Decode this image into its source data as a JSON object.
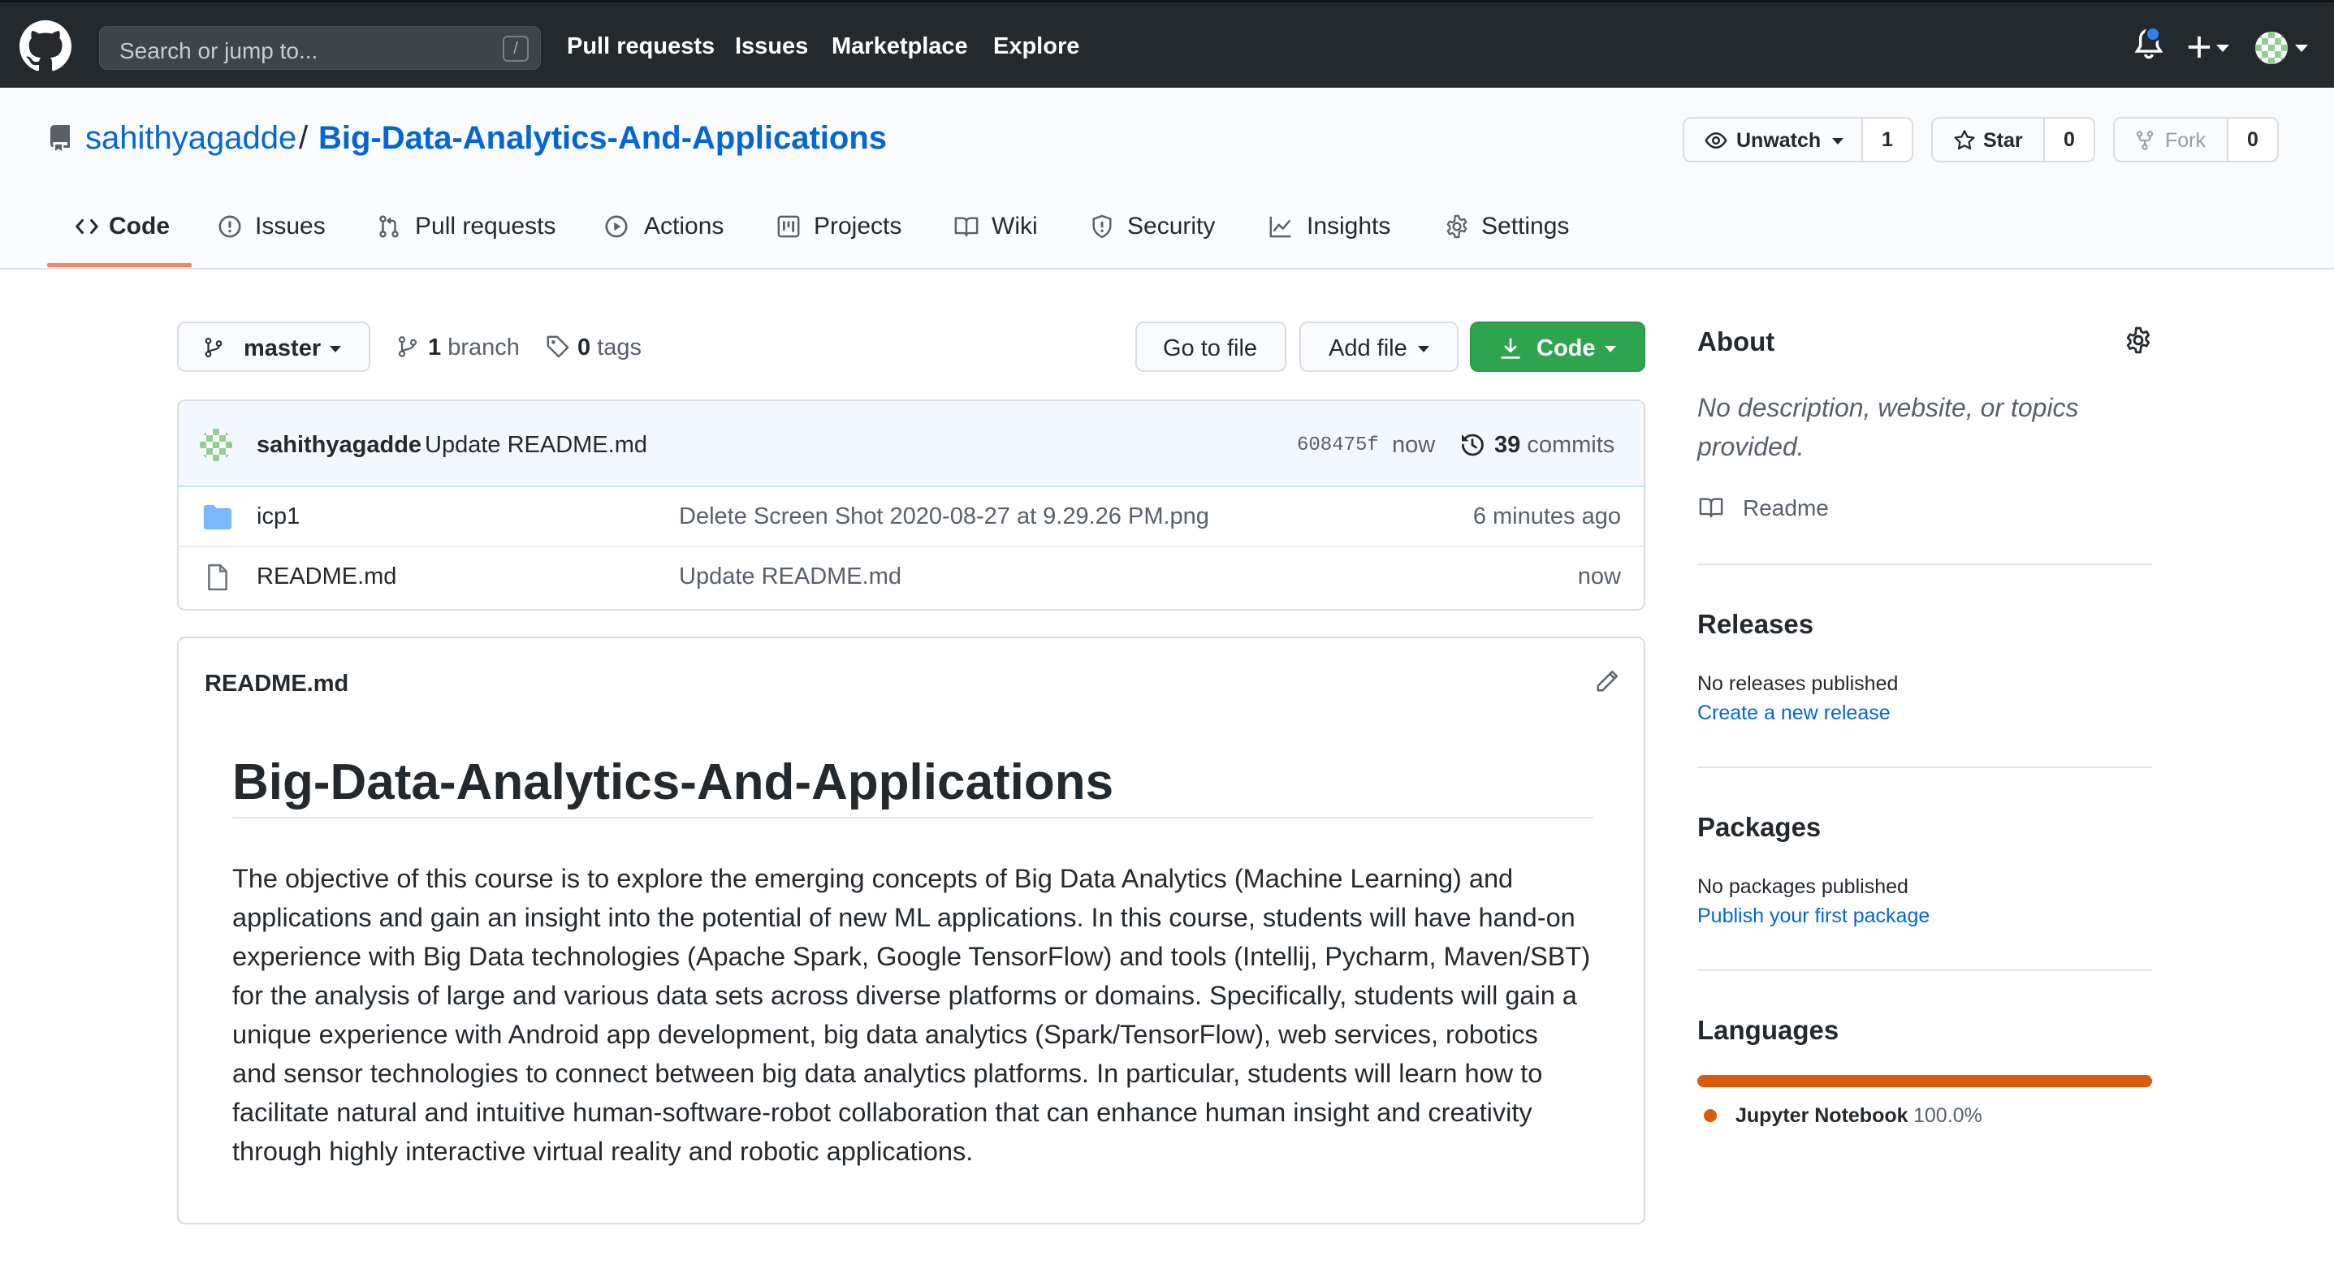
{
  "header": {
    "search_placeholder": "Search or jump to...",
    "slash_key": "/",
    "nav": [
      "Pull requests",
      "Issues",
      "Marketplace",
      "Explore"
    ],
    "icons": [
      "github-logo",
      "bell-icon",
      "plus-icon",
      "avatar"
    ]
  },
  "repo": {
    "owner": "sahithyagadde",
    "separator": "/",
    "name": "Big-Data-Analytics-And-Applications",
    "watch": {
      "label": "Unwatch",
      "count": "1"
    },
    "star": {
      "label": "Star",
      "count": "0"
    },
    "fork": {
      "label": "Fork",
      "count": "0"
    }
  },
  "tabs": [
    "Code",
    "Issues",
    "Pull requests",
    "Actions",
    "Projects",
    "Wiki",
    "Security",
    "Insights",
    "Settings"
  ],
  "browser": {
    "branch": "master",
    "branch_count": "1",
    "branch_word": "branch",
    "tag_count": "0",
    "tag_word": "tags",
    "go_to_file": "Go to file",
    "add_file": "Add file",
    "code": "Code"
  },
  "commit": {
    "author": "sahithyagadde",
    "message": "Update README.md",
    "sha": "608475f",
    "time": "now",
    "count": "39",
    "count_word": "commits"
  },
  "files": [
    {
      "name": "icp1",
      "type": "folder",
      "message": "Delete Screen Shot 2020-08-27 at 9.29.26 PM.png",
      "time": "6 minutes ago"
    },
    {
      "name": "README.md",
      "type": "file",
      "message": "Update README.md",
      "time": "now"
    }
  ],
  "readme": {
    "filename": "README.md",
    "heading": "Big-Data-Analytics-And-Applications",
    "lines": [
      "The objective of this course is to explore the emerging concepts of Big Data Analytics (Machine Learning) and",
      "applications and gain an insight into the potential of new ML applications. In this course, students will have hand-on",
      "experience with Big Data technologies (Apache Spark, Google TensorFlow) and tools (Intellij, Pycharm, Maven/SBT)",
      "for the analysis of large and various data sets across diverse platforms or domains. Specifically, students will gain a",
      "unique experience with Android app development, big data analytics (Spark/TensorFlow), web services, robotics",
      "and sensor technologies to connect between big data analytics platforms. In particular, students will learn how to",
      "facilitate natural and intuitive human-software-robot collaboration that can enhance human insight and creativity",
      "through highly interactive virtual reality and robotic applications."
    ]
  },
  "sidebar": {
    "about_title": "About",
    "about_desc": "No description, website, or topics provided.",
    "readme_link": "Readme",
    "releases_title": "Releases",
    "releases_text": "No releases published",
    "releases_link": "Create a new release",
    "packages_title": "Packages",
    "packages_text": "No packages published",
    "packages_link": "Publish your first package",
    "languages_title": "Languages",
    "language_name": "Jupyter Notebook",
    "language_percent": "100.0%",
    "language_share": 1.0,
    "language_color": "#da5b0b"
  },
  "colors": {
    "header_bg": "#24292e",
    "link": "#0366d6",
    "primary_button": "#2ea44f",
    "tab_underline": "#f9826c"
  }
}
